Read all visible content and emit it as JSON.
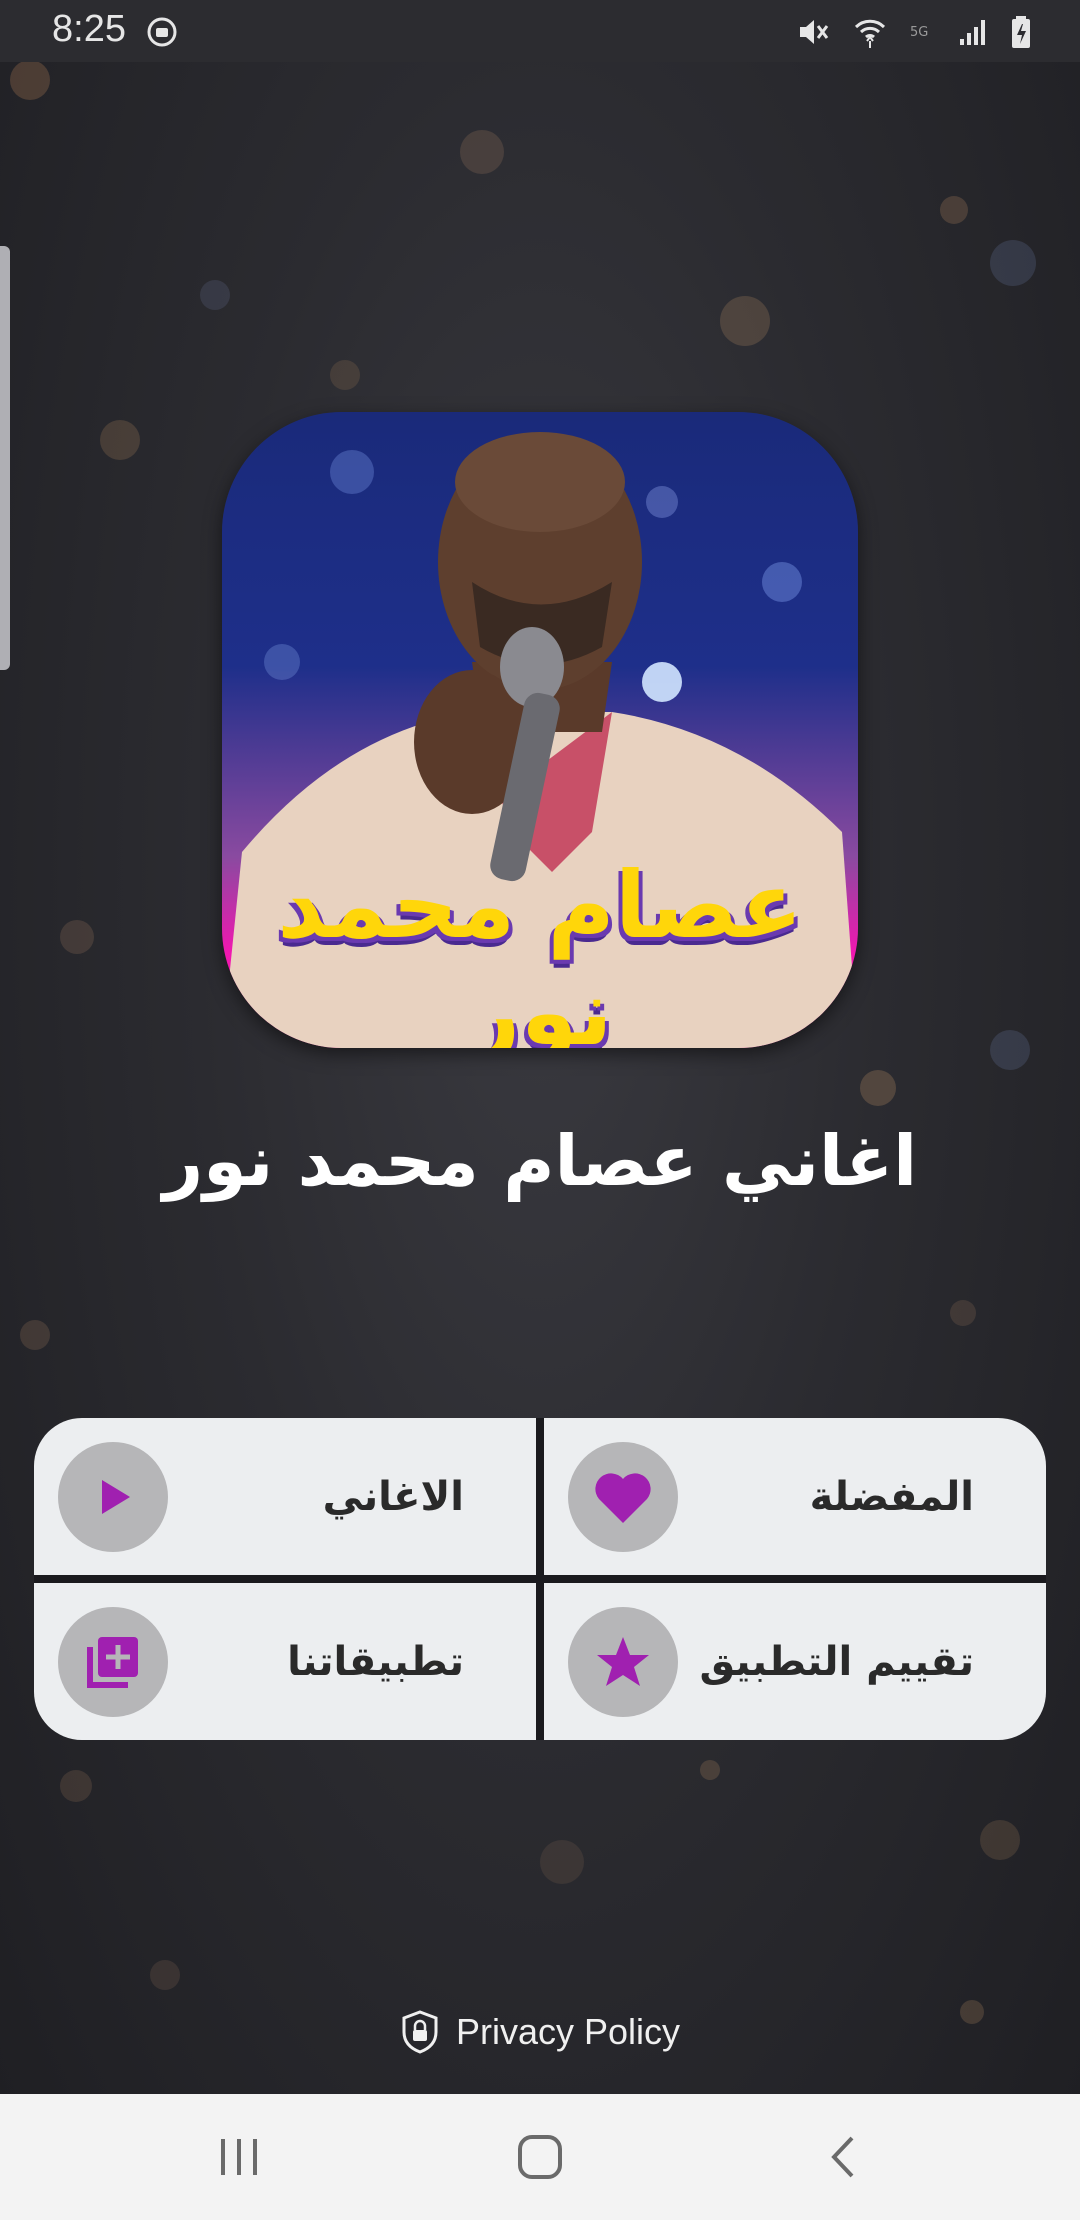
{
  "status_bar": {
    "time": "8:25"
  },
  "app": {
    "icon_caption": "عصام محمد نور",
    "title": "اغاني عصام محمد نور"
  },
  "menu": {
    "songs": "الاغاني",
    "favorites": "المفضلة",
    "our_apps": "تطبيقاتنا",
    "rate_app": "تقييم التطبيق"
  },
  "footer": {
    "privacy_policy": "Privacy Policy"
  },
  "colors": {
    "accent": "#a020b0",
    "background": "#2b2b30",
    "menu_cell": "#eceef0",
    "circle": "#b6b6b8"
  },
  "icons": {
    "songs": "play-icon",
    "favorites": "heart-icon",
    "our_apps": "add-library-icon",
    "rate_app": "star-icon",
    "privacy": "shield-lock-icon"
  }
}
